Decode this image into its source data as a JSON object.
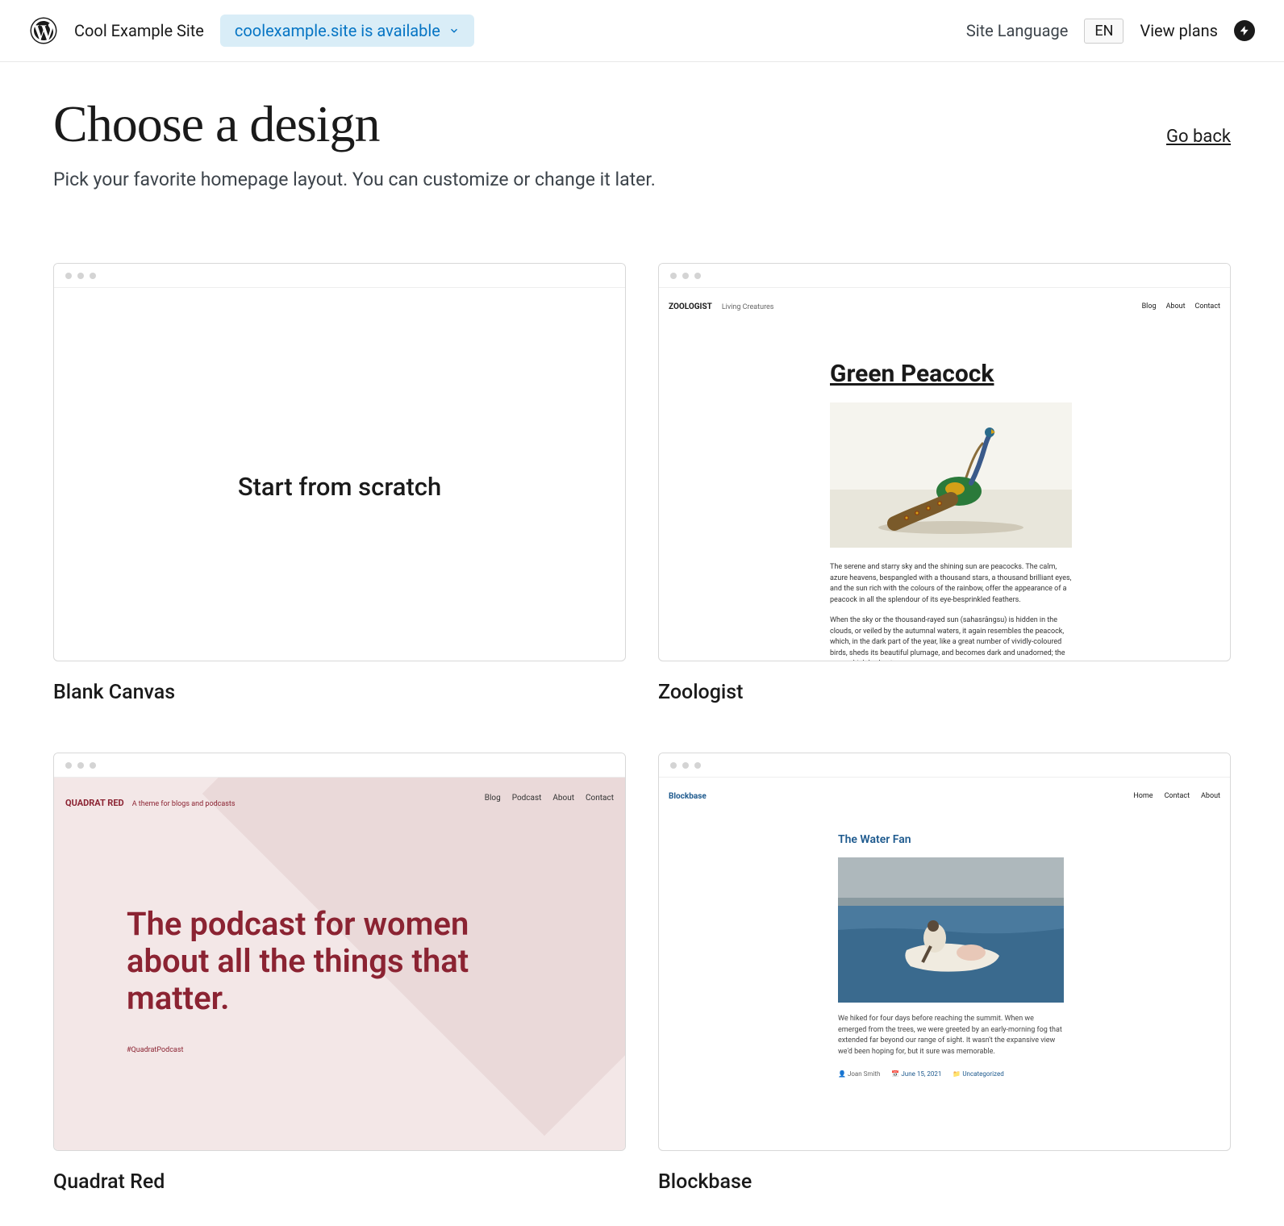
{
  "header": {
    "site_name": "Cool Example Site",
    "domain_pill": "coolexample.site is available",
    "lang_label": "Site Language",
    "lang_value": "EN",
    "view_plans": "View plans"
  },
  "page": {
    "title": "Choose a design",
    "subtitle": "Pick your favorite homepage layout. You can customize or change it later.",
    "go_back": "Go back"
  },
  "themes": {
    "blank": {
      "label": "Blank Canvas",
      "body": "Start from scratch"
    },
    "zoologist": {
      "label": "Zoologist",
      "brand": "ZOOLOGIST",
      "tagline": "Living Creatures",
      "nav": [
        "Blog",
        "About",
        "Contact"
      ],
      "post_title": "Green Peacock",
      "p1": "The serene and starry sky and the shining sun are peacocks. The calm, azure heavens, bespangled with a thousand stars, a thousand brilliant eyes, and the sun rich with the colours of the rainbow, offer the appearance of a peacock in all the splendour of its eye-besprinkled feathers.",
      "p2": "When the sky or the thousand-rayed sun (sahasrângsu) is hidden in the clouds, or veiled by the autumnal waters, it again resembles the peacock, which, in the dark part of the year, like a great number of vividly-coloured birds, sheds its beautiful plumage, and becomes dark and unadorned; the crow which had put"
    },
    "quadrat": {
      "label": "Quadrat Red",
      "brand": "QUADRAT RED",
      "tagline": "A theme for blogs and podcasts",
      "nav": [
        "Blog",
        "Podcast",
        "About",
        "Contact"
      ],
      "headline": "The podcast for women about all the things that matter.",
      "hashtag": "#QuadratPodcast"
    },
    "blockbase": {
      "label": "Blockbase",
      "brand": "Blockbase",
      "nav": [
        "Home",
        "Contact",
        "About"
      ],
      "post_title": "The Water Fan",
      "p1": "We hiked for four days before reaching the summit. When we emerged from the trees, we were greeted by an early-morning fog that extended far beyond our range of sight. It wasn't the expansive view we'd been hoping for, but it sure was memorable.",
      "author": "Joan Smith",
      "date": "June 15, 2021",
      "category": "Uncategorized"
    }
  }
}
